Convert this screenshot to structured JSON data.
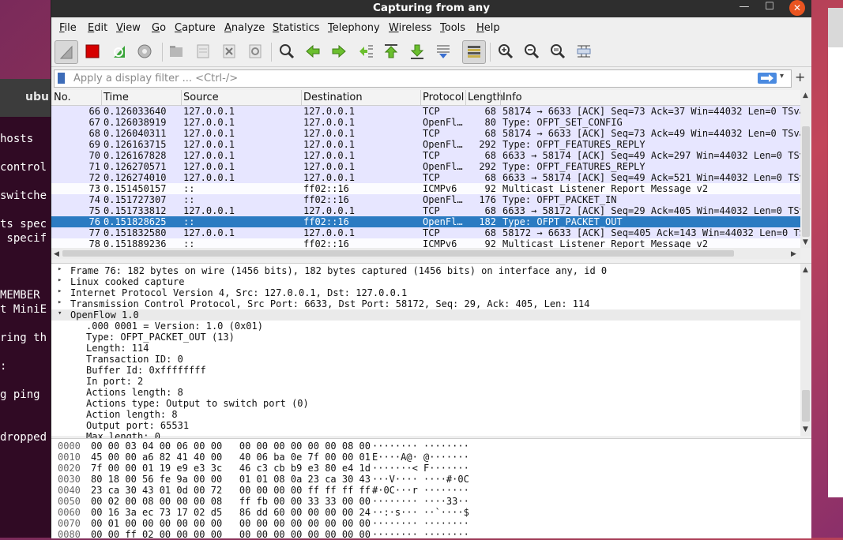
{
  "window": {
    "title": "Capturing from any"
  },
  "background": {
    "terminal_tab": "ubu",
    "terminal_lines": [
      "hosts",
      "control",
      "switche",
      "ts spec",
      " specif",
      "",
      "MEMBER",
      "t MiniE",
      "ring th",
      ":",
      "g ping",
      "dropped"
    ]
  },
  "menu": [
    "File",
    "Edit",
    "View",
    "Go",
    "Capture",
    "Analyze",
    "Statistics",
    "Telephony",
    "Wireless",
    "Tools",
    "Help"
  ],
  "toolbar": {
    "buttons": [
      "shark-fin-icon",
      "stop-icon",
      "restart-icon",
      "options-icon",
      "open-icon",
      "save-icon",
      "close-file-icon",
      "reload-icon",
      "find-icon",
      "go-back-icon",
      "go-forward-icon",
      "go-to-packet-icon",
      "first-packet-icon",
      "last-packet-icon",
      "auto-scroll-icon",
      "colorize-icon",
      "zoom-in-icon",
      "zoom-out-icon",
      "normal-size-icon",
      "resize-columns-icon"
    ]
  },
  "filter": {
    "placeholder": "Apply a display filter ... <Ctrl-/>"
  },
  "packet_list": {
    "columns": [
      "No.",
      "Time",
      "Source",
      "Destination",
      "Protocol",
      "Length",
      "Info"
    ],
    "rows": [
      {
        "no": "66",
        "time": "0.126033640",
        "src": "127.0.0.1",
        "dst": "127.0.0.1",
        "proto": "TCP",
        "len": "68",
        "info": "58174 → 6633 [ACK] Seq=73 Ack=37 Win=44032 Len=0 TSva",
        "style": "tcp"
      },
      {
        "no": "67",
        "time": "0.126038919",
        "src": "127.0.0.1",
        "dst": "127.0.0.1",
        "proto": "OpenFl…",
        "len": "80",
        "info": "Type: OFPT_SET_CONFIG",
        "style": "tcp"
      },
      {
        "no": "68",
        "time": "0.126040311",
        "src": "127.0.0.1",
        "dst": "127.0.0.1",
        "proto": "TCP",
        "len": "68",
        "info": "58174 → 6633 [ACK] Seq=73 Ack=49 Win=44032 Len=0 TSva",
        "style": "tcp"
      },
      {
        "no": "69",
        "time": "0.126163715",
        "src": "127.0.0.1",
        "dst": "127.0.0.1",
        "proto": "OpenFl…",
        "len": "292",
        "info": "Type: OFPT_FEATURES_REPLY",
        "style": "tcp"
      },
      {
        "no": "70",
        "time": "0.126167828",
        "src": "127.0.0.1",
        "dst": "127.0.0.1",
        "proto": "TCP",
        "len": "68",
        "info": "6633 → 58174 [ACK] Seq=49 Ack=297 Win=44032 Len=0 TSv",
        "style": "tcp"
      },
      {
        "no": "71",
        "time": "0.126270571",
        "src": "127.0.0.1",
        "dst": "127.0.0.1",
        "proto": "OpenFl…",
        "len": "292",
        "info": "Type: OFPT_FEATURES_REPLY",
        "style": "tcp"
      },
      {
        "no": "72",
        "time": "0.126274010",
        "src": "127.0.0.1",
        "dst": "127.0.0.1",
        "proto": "TCP",
        "len": "68",
        "info": "6633 → 58174 [ACK] Seq=49 Ack=521 Win=44032 Len=0 TSv",
        "style": "tcp"
      },
      {
        "no": "73",
        "time": "0.151450157",
        "src": "::",
        "dst": "ff02::16",
        "proto": "ICMPv6",
        "len": "92",
        "info": "Multicast Listener Report Message v2",
        "style": "udp"
      },
      {
        "no": "74",
        "time": "0.151727307",
        "src": "::",
        "dst": "ff02::16",
        "proto": "OpenFl…",
        "len": "176",
        "info": "Type: OFPT_PACKET_IN",
        "style": "tcp"
      },
      {
        "no": "75",
        "time": "0.151733812",
        "src": "127.0.0.1",
        "dst": "127.0.0.1",
        "proto": "TCP",
        "len": "68",
        "info": "6633 → 58172 [ACK] Seq=29 Ack=405 Win=44032 Len=0 TSv",
        "style": "tcp"
      },
      {
        "no": "76",
        "time": "0.151828625",
        "src": "::",
        "dst": "ff02::16",
        "proto": "OpenFl…",
        "len": "182",
        "info": "Type: OFPT_PACKET_OUT",
        "style": "sel"
      },
      {
        "no": "77",
        "time": "0.151832580",
        "src": "127.0.0.1",
        "dst": "127.0.0.1",
        "proto": "TCP",
        "len": "68",
        "info": "58172 → 6633 [ACK] Seq=405 Ack=143 Win=44032 Len=0 TS",
        "style": "tcp"
      },
      {
        "no": "78",
        "time": "0.151889236",
        "src": "::",
        "dst": "ff02::16",
        "proto": "ICMPv6",
        "len": "92",
        "info": "Multicast Listener Report Message v2",
        "style": "udp"
      }
    ]
  },
  "details": [
    {
      "text": "Frame 76: 182 bytes on wire (1456 bits), 182 bytes captured (1456 bits) on interface any, id 0",
      "indent": 0,
      "tri": "▸",
      "hl": false
    },
    {
      "text": "Linux cooked capture",
      "indent": 0,
      "tri": "▸",
      "hl": false
    },
    {
      "text": "Internet Protocol Version 4, Src: 127.0.0.1, Dst: 127.0.0.1",
      "indent": 0,
      "tri": "▸",
      "hl": false
    },
    {
      "text": "Transmission Control Protocol, Src Port: 6633, Dst Port: 58172, Seq: 29, Ack: 405, Len: 114",
      "indent": 0,
      "tri": "▸",
      "hl": false
    },
    {
      "text": "OpenFlow 1.0",
      "indent": 0,
      "tri": "▾",
      "hl": true
    },
    {
      "text": ".000 0001 = Version: 1.0 (0x01)",
      "indent": 1,
      "tri": "",
      "hl": false
    },
    {
      "text": "Type: OFPT_PACKET_OUT (13)",
      "indent": 1,
      "tri": "",
      "hl": false
    },
    {
      "text": "Length: 114",
      "indent": 1,
      "tri": "",
      "hl": false
    },
    {
      "text": "Transaction ID: 0",
      "indent": 1,
      "tri": "",
      "hl": false
    },
    {
      "text": "Buffer Id: 0xffffffff",
      "indent": 1,
      "tri": "",
      "hl": false
    },
    {
      "text": "In port: 2",
      "indent": 1,
      "tri": "",
      "hl": false
    },
    {
      "text": "Actions length: 8",
      "indent": 1,
      "tri": "",
      "hl": false
    },
    {
      "text": "Actions type: Output to switch port (0)",
      "indent": 1,
      "tri": "",
      "hl": false
    },
    {
      "text": "Action length: 8",
      "indent": 1,
      "tri": "",
      "hl": false
    },
    {
      "text": "Output port: 65531",
      "indent": 1,
      "tri": "",
      "hl": false
    },
    {
      "text": "Max length: 0",
      "indent": 1,
      "tri": "",
      "hl": false
    }
  ],
  "bytes": [
    {
      "off": "0000",
      "hex": "00 00 03 04 00 06 00 00   00 00 00 00 00 00 08 00",
      "ascii": "········ ········"
    },
    {
      "off": "0010",
      "hex": "45 00 00 a6 82 41 40 00   40 06 ba 0e 7f 00 00 01",
      "ascii": "E····A@· @·······"
    },
    {
      "off": "0020",
      "hex": "7f 00 00 01 19 e9 e3 3c   46 c3 cb b9 e3 80 e4 1d",
      "ascii": "·······< F·······"
    },
    {
      "off": "0030",
      "hex": "80 18 00 56 fe 9a 00 00   01 01 08 0a 23 ca 30 43",
      "ascii": "···V···· ····#·0C"
    },
    {
      "off": "0040",
      "hex": "23 ca 30 43 01 0d 00 72   00 00 00 00 ff ff ff ff",
      "ascii": "#·0C···r ········"
    },
    {
      "off": "0050",
      "hex": "00 02 00 08 00 00 00 08   ff fb 00 00 33 33 00 00",
      "ascii": "········ ····33··"
    },
    {
      "off": "0060",
      "hex": "00 16 3a ec 73 17 02 d5   86 dd 60 00 00 00 00 24",
      "ascii": "··:·s··· ··`····$"
    },
    {
      "off": "0070",
      "hex": "00 01 00 00 00 00 00 00   00 00 00 00 00 00 00 00",
      "ascii": "········ ········"
    },
    {
      "off": "0080",
      "hex": "00 00 ff 02 00 00 00 00   00 00 00 00 00 00 00 00",
      "ascii": "········ ········"
    }
  ],
  "colors": {
    "selected_row": "#2b7bc2",
    "tcp_row": "#e7e6ff",
    "title_bar": "#2e2e2e",
    "close_button": "#e95420"
  }
}
